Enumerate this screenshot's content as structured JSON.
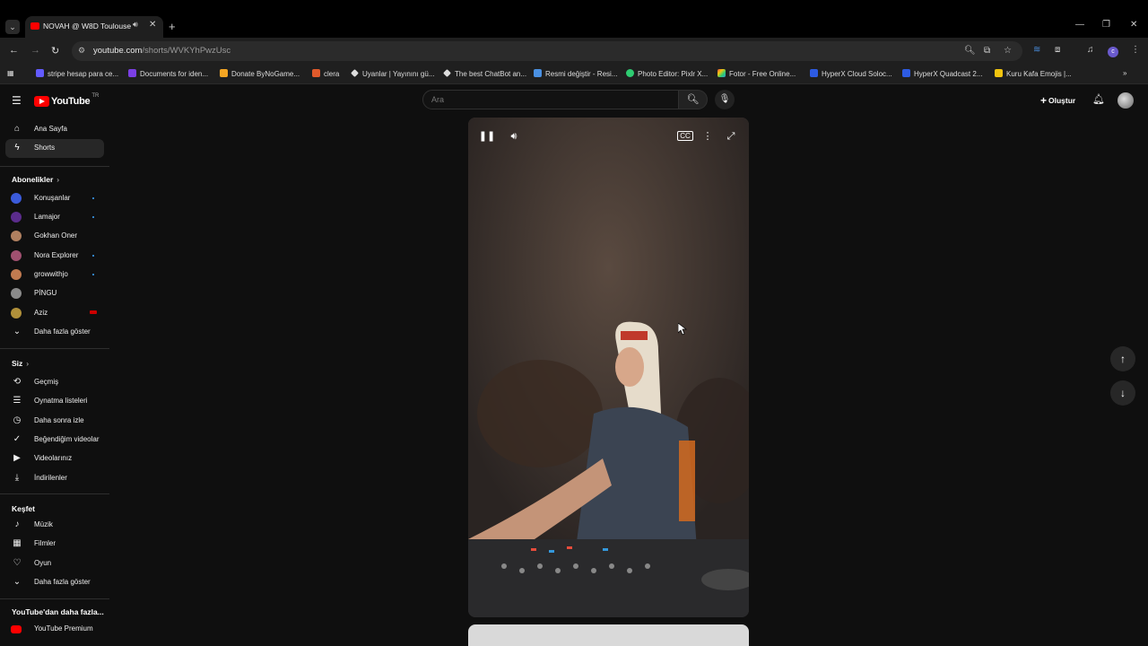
{
  "browser": {
    "tab_title": "NOVAH @ W8D Toulouse -",
    "url_host": "youtube.com",
    "url_path": "/shorts/WVKYhPwzUsc",
    "bookmarks": [
      {
        "label": "stripe hesap para ce...",
        "color": "#635bff"
      },
      {
        "label": "Documents for iden...",
        "color": "#7b3fe4"
      },
      {
        "label": "Donate ByNoGame...",
        "color": "#f5a623"
      },
      {
        "label": "clera",
        "color": "#e05a2b"
      },
      {
        "label": "Uyanlar | Yayınını gü...",
        "color": "#dddddd"
      },
      {
        "label": "The best ChatBot an...",
        "color": "#dddddd"
      },
      {
        "label": "Resmi değiştir - Resi...",
        "color": "#4a90e2"
      },
      {
        "label": "Photo Editor: Pixlr X...",
        "color": "#2ecc71"
      },
      {
        "label": "Fotor - Free Online...",
        "color": "#e74c3c"
      },
      {
        "label": "HyperX Cloud Soloc...",
        "color": "#2d5be3"
      },
      {
        "label": "HyperX Quadcast 2...",
        "color": "#2d5be3"
      },
      {
        "label": "Kuru Kafa Emojis |...",
        "color": "#f1c40f"
      }
    ]
  },
  "youtube": {
    "logo_text": "YouTube",
    "logo_country": "TR",
    "search_placeholder": "Ara",
    "create_label": "Oluştur",
    "nav": {
      "home": "Ana Sayfa",
      "shorts": "Shorts"
    },
    "subscriptions_title": "Abonelikler",
    "subscriptions": [
      {
        "name": "Konuşanlar",
        "color": "#3b5bdb",
        "indicator": "dot"
      },
      {
        "name": "Lamajor",
        "color": "#5b2c8c",
        "indicator": "dot"
      },
      {
        "name": "Gokhan Oner",
        "color": "#b08060",
        "indicator": "none"
      },
      {
        "name": "Nora Explorer",
        "color": "#a05070",
        "indicator": "dot"
      },
      {
        "name": "growwithjo",
        "color": "#c07a50",
        "indicator": "dot"
      },
      {
        "name": "PİNGU",
        "color": "#8a8a8a",
        "indicator": "none"
      },
      {
        "name": "Aziz",
        "color": "#b0903a",
        "indicator": "live"
      }
    ],
    "show_more": "Daha fazla göster",
    "you_title": "Siz",
    "you_items": [
      {
        "label": "Geçmiş",
        "icon": "history-icon",
        "glyph": "⟲"
      },
      {
        "label": "Oynatma listeleri",
        "icon": "playlist-icon",
        "glyph": "☰"
      },
      {
        "label": "Daha sonra izle",
        "icon": "clock-icon",
        "glyph": "◷"
      },
      {
        "label": "Beğendiğim videolar",
        "icon": "thumbs-up-icon",
        "glyph": "👍"
      },
      {
        "label": "Videolarınız",
        "icon": "video-icon",
        "glyph": "▶"
      },
      {
        "label": "İndirilenler",
        "icon": "download-icon",
        "glyph": "⤓"
      }
    ],
    "explore_title": "Keşfet",
    "explore_items": [
      {
        "label": "Müzik",
        "icon": "music-icon",
        "glyph": "♪"
      },
      {
        "label": "Filmler",
        "icon": "film-icon",
        "glyph": "▦"
      },
      {
        "label": "Oyun",
        "icon": "gaming-icon",
        "glyph": "♡"
      }
    ],
    "more_from_title": "YouTube'dan daha fazla...",
    "premium_label": "YouTube Premium"
  }
}
